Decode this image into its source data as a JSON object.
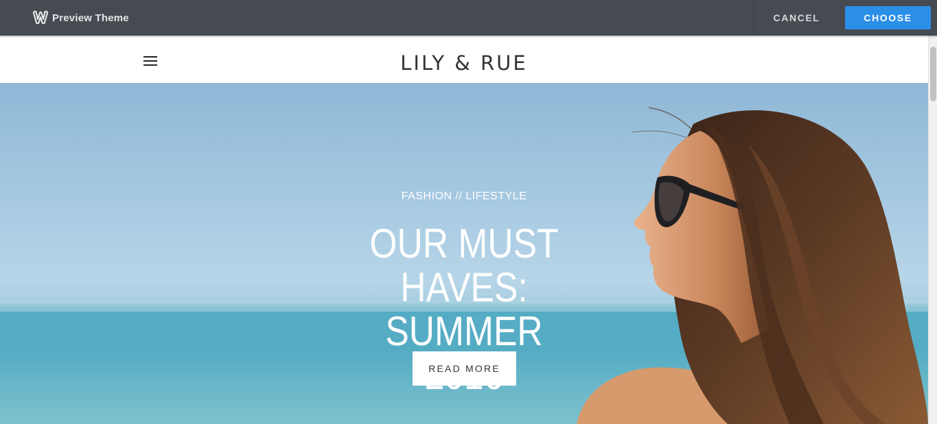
{
  "preview_bar": {
    "title": "Preview Theme",
    "logo_icon": "weebly-logo-icon",
    "cancel_label": "CANCEL",
    "choose_label": "CHOOSE",
    "choose_color": "#2b8fe8",
    "bar_color": "#454b51"
  },
  "site": {
    "title": "LILY & RUE",
    "menu_icon": "hamburger-menu-icon"
  },
  "hero": {
    "category": "FASHION // LIFESTYLE",
    "title_line1": "OUR MUST HAVES:",
    "title_line2": "SUMMER 2016",
    "button_label": "READ MORE"
  }
}
